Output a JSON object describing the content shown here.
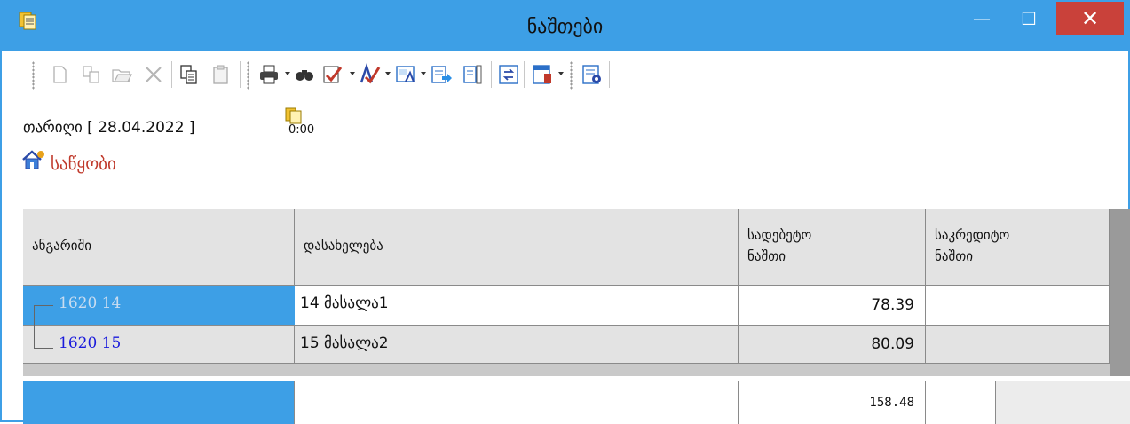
{
  "window": {
    "title": "ნაშთები",
    "min_symbol": "—",
    "max_symbol": "☐",
    "close_symbol": "✕",
    "accent": "#3d9fe6",
    "close_color": "#c9413a"
  },
  "toolbar": {
    "icons": [
      "new-icon",
      "copy-record-icon",
      "open-folder-icon",
      "delete-icon",
      "copy-icon",
      "paste-icon",
      "print-icon",
      "find-icon",
      "filter-icon",
      "sort-icon",
      "spellcheck-icon",
      "export-icon",
      "columns-icon",
      "refresh-icon",
      "settings-icon",
      "options-icon"
    ]
  },
  "header": {
    "date_label": "თარიღი [ 28.04.2022 ]",
    "time_value": "0:00",
    "home_link": "საწყობი"
  },
  "table": {
    "columns": [
      "ანგარიში",
      "დასახელება",
      "სადებეტო ნაშთი",
      "საკრედიტო ნაშთი"
    ],
    "column_lines": [
      [
        "სადებეტო",
        "ნაშთი"
      ],
      [
        "საკრედიტო",
        "ნაშთი"
      ]
    ],
    "rows": [
      {
        "account": "1620 14",
        "name": "14 მასალა1",
        "debit": "78.39",
        "credit": ""
      },
      {
        "account": "1620 15",
        "name": "15 მასალა2",
        "debit": "80.09",
        "credit": ""
      }
    ],
    "total_debit": "158.48",
    "selected_color": "#3d9fe6",
    "link_color": "#1a1adc"
  }
}
